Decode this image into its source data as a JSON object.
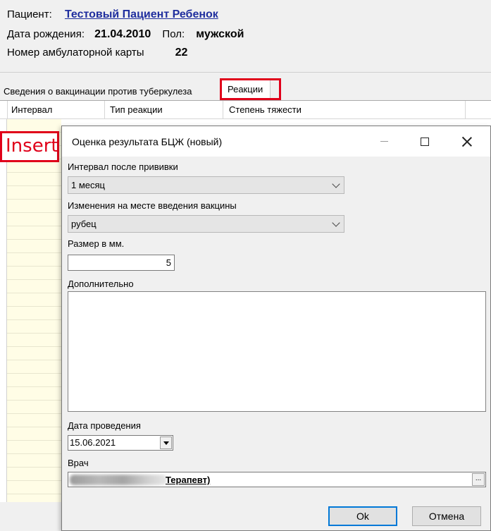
{
  "patient": {
    "label_patient": "Пациент:",
    "name": "Тестовый Пациент Ребенок",
    "label_birth": "Дата рождения:",
    "birth_date": "21.04.2010",
    "label_sex": "Пол:",
    "sex": "мужской",
    "label_card": "Номер амбулаторной карты",
    "card_number": "22"
  },
  "tabs": [
    {
      "label": "Сведения о вакцинации против туберкулеза"
    },
    {
      "label": "Реакции"
    }
  ],
  "grid": {
    "columns": [
      "Интервал",
      "Тип реакции",
      "Степень тяжести"
    ]
  },
  "annotation": {
    "insert_label": "Insert"
  },
  "dialog": {
    "title": "Оценка результата БЦЖ (новый)",
    "interval_label": "Интервал после прививки",
    "interval_value": "1 месяц",
    "changes_label": "Изменения на месте введения вакцины",
    "changes_value": "рубец",
    "size_label": "Размер в мм.",
    "size_value": "5",
    "extra_label": "Дополнительно",
    "extra_value": "",
    "date_label": "Дата проведения",
    "date_value": "15.06.2021",
    "doctor_label": "Врач",
    "doctor_value": "Терапевт)",
    "ellipsis": "...",
    "ok_label": "Ok",
    "cancel_label": "Отмена"
  }
}
